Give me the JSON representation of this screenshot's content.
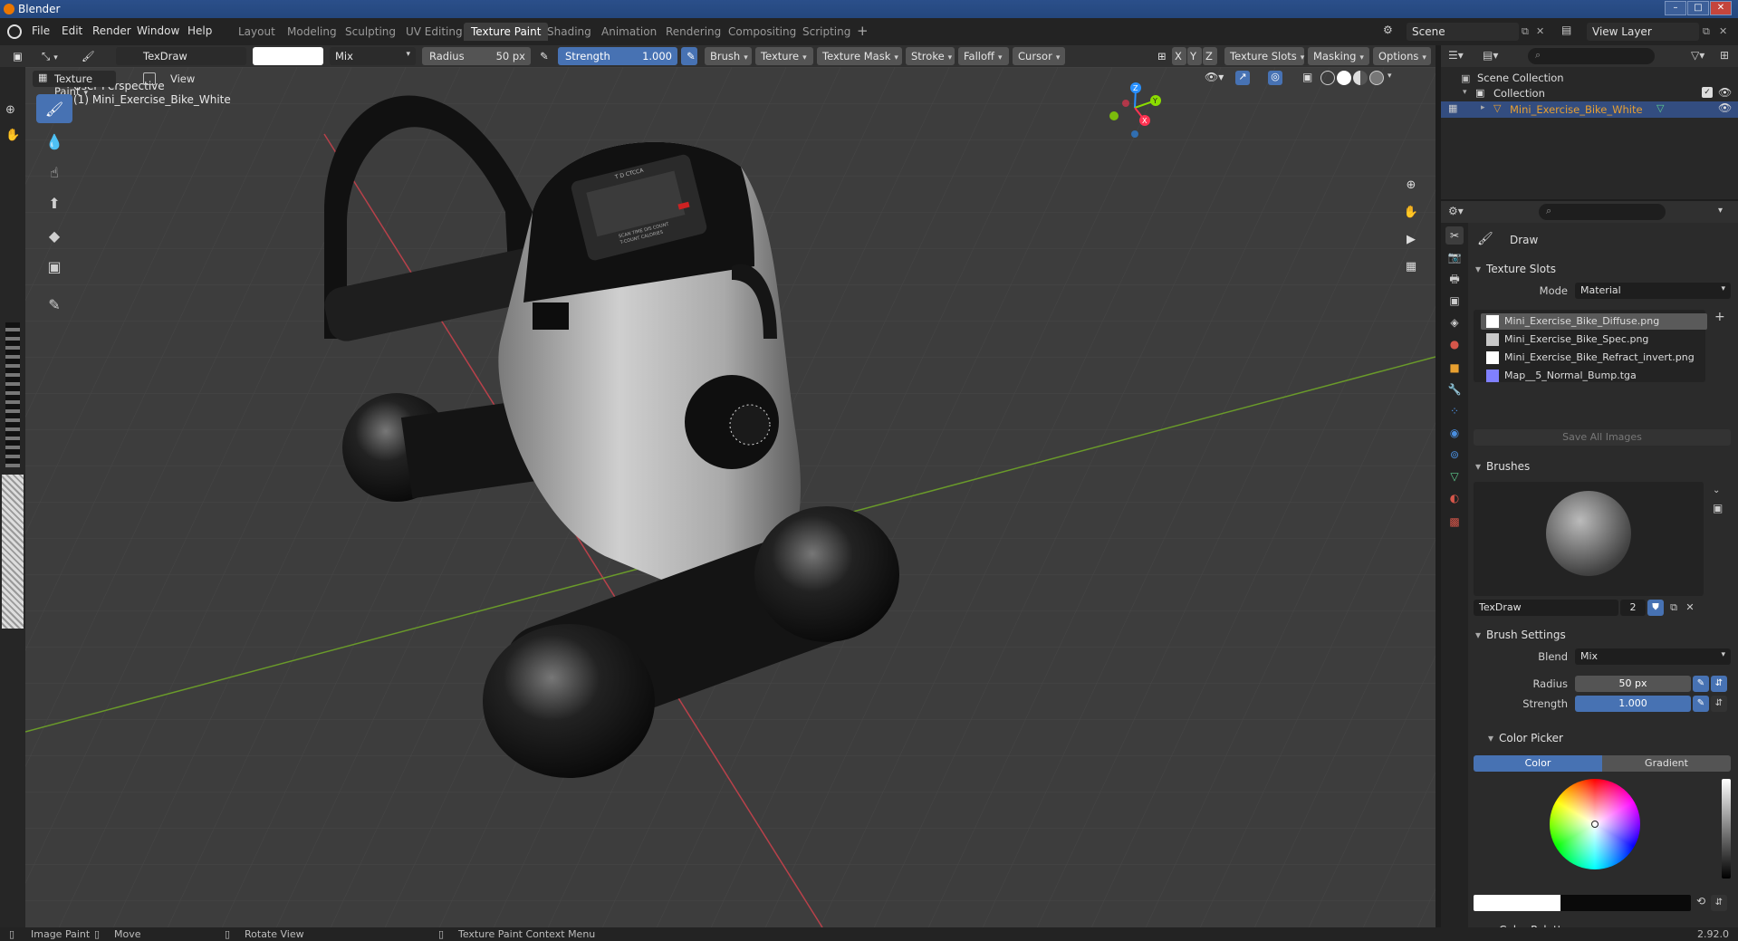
{
  "window": {
    "title": "Blender",
    "controls": [
      "–",
      "□",
      "✕"
    ]
  },
  "menu": {
    "items": [
      "File",
      "Edit",
      "Render",
      "Window",
      "Help"
    ],
    "workspaces": [
      "Layout",
      "Modeling",
      "Sculpting",
      "UV Editing",
      "Texture Paint",
      "Shading",
      "Animation",
      "Rendering",
      "Compositing",
      "Scripting"
    ],
    "active_workspace": "Texture Paint",
    "add_tab": "+",
    "scene": "Scene",
    "view_layer": "View Layer"
  },
  "tool_header": {
    "brush_name": "TexDraw",
    "blend": "Mix",
    "radius_label": "Radius",
    "radius_value": "50 px",
    "strength_label": "Strength",
    "strength_value": "1.000",
    "menus": [
      "Brush",
      "Texture",
      "Texture Mask",
      "Stroke",
      "Falloff",
      "Cursor"
    ],
    "axes": [
      "X",
      "Y",
      "Z"
    ],
    "right_menus": [
      "Texture Slots",
      "Masking",
      "Options"
    ]
  },
  "viewport_header": {
    "mode": "Texture Paint",
    "view_menu": "View"
  },
  "viewport": {
    "perspective": "User Perspective",
    "object_label": "(1) Mini_Exercise_Bike_White",
    "gizmo": {
      "x": "X",
      "y": "Y",
      "z": "Z"
    },
    "screen_labels": [
      "T D CTCCA",
      "SCAN TIME DIS COUNT",
      "T-COUNT CALORIES"
    ]
  },
  "outliner": {
    "scene_collection": "Scene Collection",
    "collection": "Collection",
    "object": "Mini_Exercise_Bike_White"
  },
  "properties": {
    "active_tool": "Draw",
    "texture_slots": {
      "title": "Texture Slots",
      "mode_label": "Mode",
      "mode_value": "Material",
      "items": [
        {
          "name": "Mini_Exercise_Bike_Diffuse.png",
          "selected": true,
          "color": "#ffffff"
        },
        {
          "name": "Mini_Exercise_Bike_Spec.png",
          "selected": false,
          "color": "#c8c8c8"
        },
        {
          "name": "Mini_Exercise_Bike_Refract_invert.png",
          "selected": false,
          "color": "#ffffff"
        },
        {
          "name": "Map__5_Normal_Bump.tga",
          "selected": false,
          "color": "#8080ff"
        }
      ],
      "save_all": "Save All Images"
    },
    "brushes": {
      "title": "Brushes",
      "brush_name": "TexDraw",
      "users": "2"
    },
    "brush_settings": {
      "title": "Brush Settings",
      "blend_label": "Blend",
      "blend_value": "Mix",
      "radius_label": "Radius",
      "radius_value": "50 px",
      "strength_label": "Strength",
      "strength_value": "1.000"
    },
    "color_picker": {
      "title": "Color Picker",
      "tabs": [
        "Color",
        "Gradient"
      ],
      "active_tab": "Color"
    },
    "color_palette": {
      "title": "Color Palette"
    }
  },
  "statusbar": {
    "items": [
      "Image Paint",
      "Move",
      "Rotate View",
      "Texture Paint Context Menu"
    ],
    "version": "2.92.0"
  },
  "colors": {
    "accent": "#4772b3",
    "selected_object": "#e8a030",
    "x_axis": "#ff3352",
    "y_axis": "#8bdc00",
    "z_axis": "#2890ff"
  }
}
